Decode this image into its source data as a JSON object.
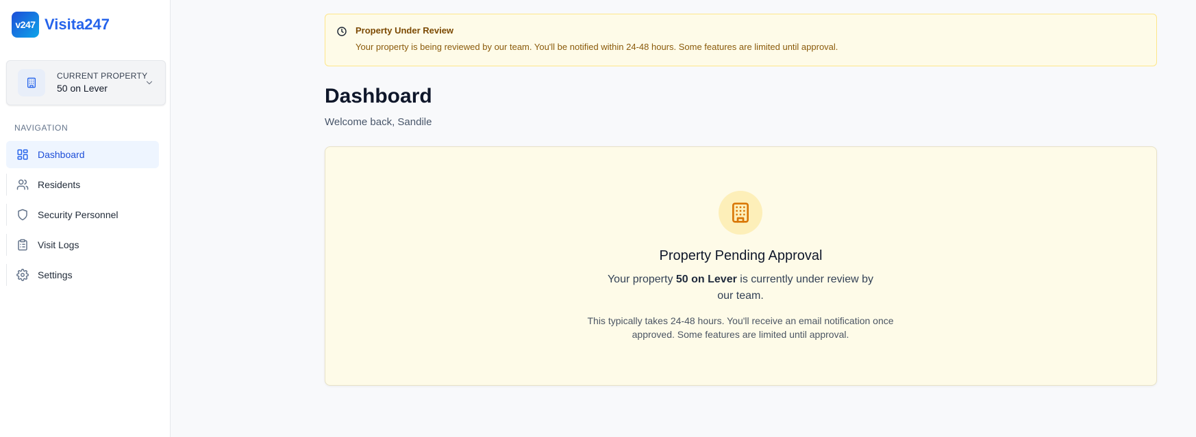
{
  "brand": {
    "logo_text": "v247",
    "name": "Visita247"
  },
  "current_property": {
    "caption": "CURRENT PROPERTY",
    "name": "50 on Lever"
  },
  "nav": {
    "heading": "NAVIGATION",
    "items": [
      {
        "label": "Dashboard",
        "icon": "dashboard-icon",
        "active": true
      },
      {
        "label": "Residents",
        "icon": "users-icon",
        "active": false
      },
      {
        "label": "Security Personnel",
        "icon": "shield-icon",
        "active": false
      },
      {
        "label": "Visit Logs",
        "icon": "clipboard-list-icon",
        "active": false
      },
      {
        "label": "Settings",
        "icon": "gear-icon",
        "active": false
      }
    ]
  },
  "alert": {
    "icon": "clock-icon",
    "title": "Property Under Review",
    "body": "Your property is being reviewed by our team. You'll be notified within 24-48 hours. Some features are limited until approval."
  },
  "page": {
    "title": "Dashboard",
    "welcome": "Welcome back, Sandile"
  },
  "pending": {
    "icon": "building-icon",
    "title": "Property Pending Approval",
    "text_prefix": "Your property ",
    "property_name": "50 on Lever",
    "text_suffix": " is currently under review by our team.",
    "note": "This typically takes 24-48 hours. You'll receive an email notification once approved. Some features are limited until approval."
  },
  "colors": {
    "accent": "#2563eb",
    "active_bg": "#eef5ff",
    "warning_bg": "#fefbe8",
    "warning_text": "#7c4a03",
    "warning_icon": "#d97706"
  }
}
